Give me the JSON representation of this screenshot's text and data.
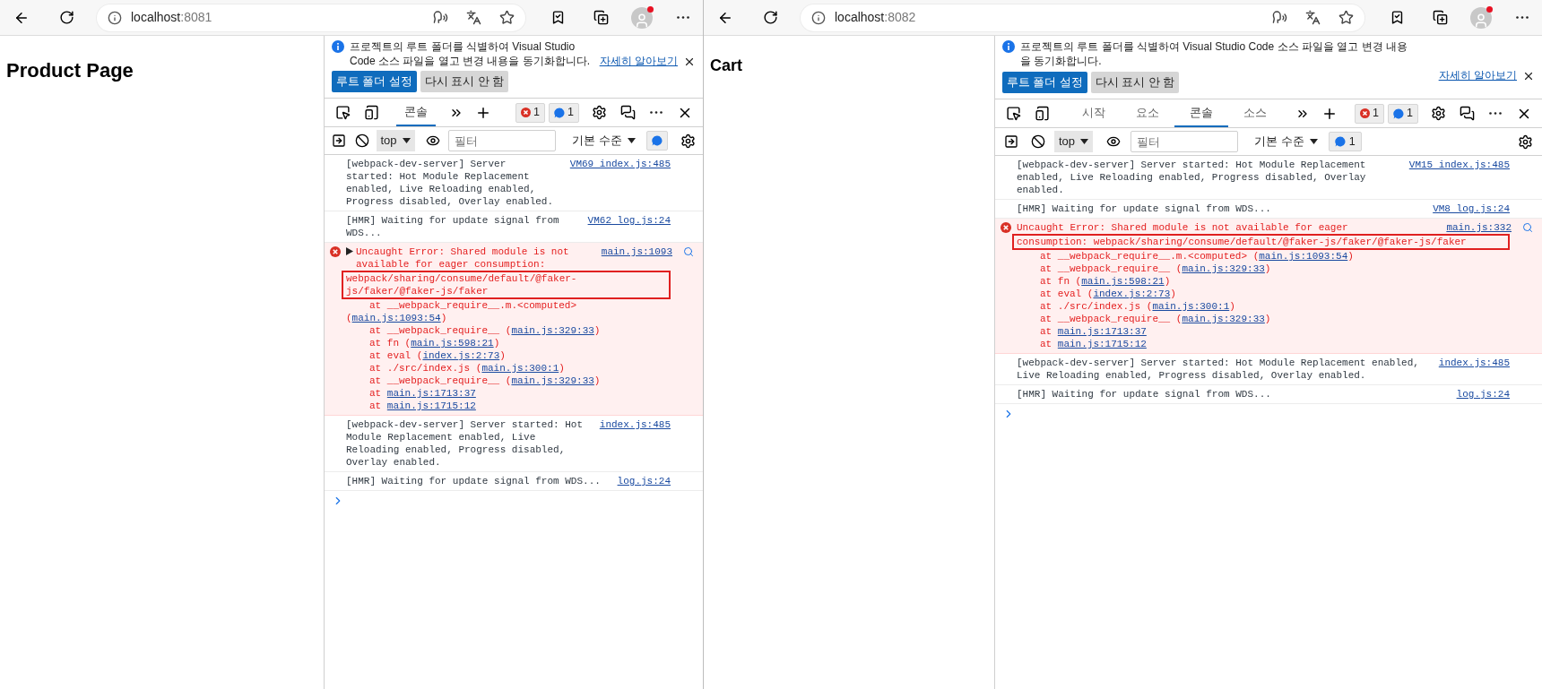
{
  "windows": [
    {
      "address": {
        "host": "localhost",
        "port": ":8081"
      },
      "page_heading": "Product Page",
      "devtools": {
        "banner": {
          "message": "프로젝트의 루트 폴더를 식별하여 Visual Studio Code 소스 파일을 열고 변경 내용을 동기화합니다.",
          "link": "자세히 알아보기",
          "buttons": [
            {
              "label": "루트 폴더 설정",
              "kind": "primary"
            },
            {
              "label": "다시 표시 안 함",
              "kind": "secondary"
            }
          ]
        },
        "tabs": [
          {
            "label": "콘솔",
            "selected": true
          }
        ],
        "error_count": "1",
        "message_count": "1",
        "context": "top",
        "filter_placeholder": "필터",
        "level": "기본 수준",
        "messages": [
          {
            "kind": "log",
            "text": "[webpack-dev-server] Server started: Hot Module Replacement enabled, Live Reloading enabled, Progress disabled, Overlay enabled.",
            "source": "VM69 index.js:485"
          },
          {
            "kind": "log",
            "text": "[HMR] Waiting for update signal from WDS...",
            "source": "VM62 log.js:24"
          },
          {
            "kind": "error",
            "collapsible": true,
            "text": "Uncaught Error: Shared module is not available for eager consumption:",
            "highlight": "webpack/sharing/consume/default/@faker-js/faker/@faker-js/faker",
            "source": "main.js:1093",
            "stack": [
              {
                "prefix": "at __webpack_require__.m.<computed> (",
                "link": "main.js:1093:54",
                "suffix": ")"
              },
              {
                "prefix": "at __webpack_require__ (",
                "link": "main.js:329:33",
                "suffix": ")"
              },
              {
                "prefix": "at fn (",
                "link": "main.js:598:21",
                "suffix": ")"
              },
              {
                "prefix": "at eval (",
                "link": "index.js:2:73",
                "suffix": ")"
              },
              {
                "prefix": "at ./src/index.js (",
                "link": "main.js:300:1",
                "suffix": ")"
              },
              {
                "prefix": "at __webpack_require__ (",
                "link": "main.js:329:33",
                "suffix": ")"
              },
              {
                "prefix": "at ",
                "link": "main.js:1713:37"
              },
              {
                "prefix": "at ",
                "link": "main.js:1715:12"
              }
            ]
          },
          {
            "kind": "log",
            "text": "[webpack-dev-server] Server started: Hot Module Replacement enabled, Live Reloading enabled, Progress disabled, Overlay enabled.",
            "source": "index.js:485"
          },
          {
            "kind": "log",
            "text": "[HMR] Waiting for update signal from WDS...",
            "source": "log.js:24"
          }
        ]
      }
    },
    {
      "address": {
        "host": "localhost",
        "port": ":8082"
      },
      "page_heading": "Cart",
      "devtools": {
        "banner": {
          "message": "프로젝트의 루트 폴더를 식별하여 Visual Studio Code 소스 파일을 열고 변경 내용을 동기화합니다.",
          "link": "자세히 알아보기",
          "buttons": [
            {
              "label": "루트 폴더 설정",
              "kind": "primary"
            },
            {
              "label": "다시 표시 안 함",
              "kind": "secondary"
            }
          ]
        },
        "tabs": [
          {
            "label": "시작",
            "selected": false
          },
          {
            "label": "요소",
            "selected": false
          },
          {
            "label": "콘솔",
            "selected": true
          },
          {
            "label": "소스",
            "selected": false
          }
        ],
        "error_count": "1",
        "message_count": "1",
        "context": "top",
        "filter_placeholder": "필터",
        "level": "기본 수준",
        "issues_count": "1",
        "messages": [
          {
            "kind": "log",
            "text": "[webpack-dev-server] Server started: Hot Module Replacement enabled, Live Reloading enabled, Progress disabled, Overlay enabled.",
            "source": "VM15 index.js:485"
          },
          {
            "kind": "log",
            "text": "[HMR] Waiting for update signal from WDS...",
            "source": "VM8 log.js:24"
          },
          {
            "kind": "error",
            "collapsible": false,
            "text": "Uncaught Error: Shared module is not available for eager",
            "highlight": "consumption: webpack/sharing/consume/default/@faker-js/faker/@faker-js/faker",
            "source": "main.js:332",
            "stack": [
              {
                "prefix": "at __webpack_require__.m.<computed> (",
                "link": "main.js:1093:54",
                "suffix": ")"
              },
              {
                "prefix": "at __webpack_require__ (",
                "link": "main.js:329:33",
                "suffix": ")"
              },
              {
                "prefix": "at fn (",
                "link": "main.js:598:21",
                "suffix": ")"
              },
              {
                "prefix": "at eval (",
                "link": "index.js:2:73",
                "suffix": ")"
              },
              {
                "prefix": "at ./src/index.js (",
                "link": "main.js:300:1",
                "suffix": ")"
              },
              {
                "prefix": "at __webpack_require__ (",
                "link": "main.js:329:33",
                "suffix": ")"
              },
              {
                "prefix": "at ",
                "link": "main.js:1713:37"
              },
              {
                "prefix": "at ",
                "link": "main.js:1715:12"
              }
            ]
          },
          {
            "kind": "log",
            "text": "[webpack-dev-server] Server started: Hot Module Replacement enabled, Live Reloading enabled, Progress disabled, Overlay enabled.",
            "source": "index.js:485"
          },
          {
            "kind": "log",
            "text": "[HMR] Waiting for update signal from WDS...",
            "source": "log.js:24"
          }
        ]
      }
    }
  ]
}
